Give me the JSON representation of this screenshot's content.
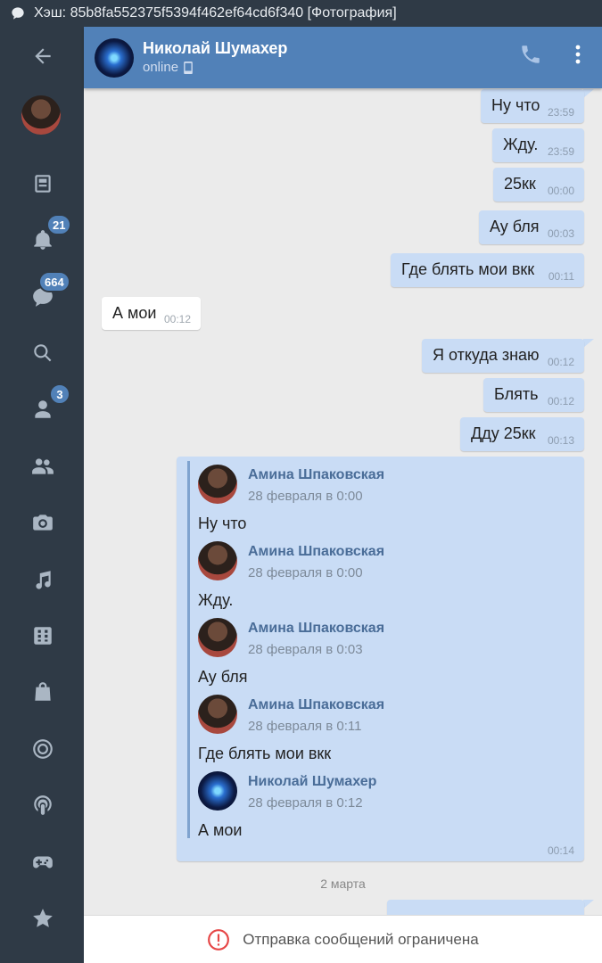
{
  "status_bar": {
    "notification": "Хэш: 85b8fa552375f5394f462ef64cd6f340 [Фотография]"
  },
  "sidebar": {
    "items": [
      {
        "name": "back",
        "icon": "arrow-left-icon"
      },
      {
        "name": "profile",
        "icon": "avatar"
      },
      {
        "name": "news",
        "icon": "newsfeed-icon"
      },
      {
        "name": "notifications",
        "icon": "bell-icon",
        "badge": "21"
      },
      {
        "name": "messages",
        "icon": "message-icon",
        "badge": "664"
      },
      {
        "name": "search",
        "icon": "search-icon"
      },
      {
        "name": "friends",
        "icon": "person-icon",
        "badge": "3"
      },
      {
        "name": "groups",
        "icon": "people-icon"
      },
      {
        "name": "photos",
        "icon": "camera-icon"
      },
      {
        "name": "music",
        "icon": "music-note-icon"
      },
      {
        "name": "apps",
        "icon": "grid-icon"
      },
      {
        "name": "market",
        "icon": "shopping-bag-icon"
      },
      {
        "name": "target",
        "icon": "target-icon"
      },
      {
        "name": "podcasts",
        "icon": "podcast-icon"
      },
      {
        "name": "games",
        "icon": "gamepad-icon"
      },
      {
        "name": "favorites",
        "icon": "star-icon"
      }
    ]
  },
  "header": {
    "title": "Николай Шумахер",
    "subtitle": "online",
    "accent": "#5181b8"
  },
  "messages": [
    {
      "text": "Ну что",
      "time": "23:59",
      "dir": "out"
    },
    {
      "text": "Жду.",
      "time": "23:59",
      "dir": "out"
    },
    {
      "text": "25кк",
      "time": "00:00",
      "dir": "out"
    },
    {
      "text": "Ау бля",
      "time": "00:03",
      "dir": "out"
    },
    {
      "text": "Где блять мои вкк",
      "time": "00:11",
      "dir": "out"
    },
    {
      "text": "А мои",
      "time": "00:12",
      "dir": "in"
    },
    {
      "text": "Я откуда знаю",
      "time": "00:12",
      "dir": "out"
    },
    {
      "text": "Блять",
      "time": "00:12",
      "dir": "out"
    },
    {
      "text": "Дду 25кк",
      "time": "00:13",
      "dir": "out"
    }
  ],
  "forwarded": {
    "time": "00:14",
    "items": [
      {
        "author": "Амина Шпаковская",
        "date": "28 февраля в 0:00",
        "text": "Ну что"
      },
      {
        "author": "Амина Шпаковская",
        "date": "28 февраля в 0:00",
        "text": "Жду."
      },
      {
        "author": "Амина Шпаковская",
        "date": "28 февраля в 0:03",
        "text": "Ау бля"
      },
      {
        "author": "Амина Шпаковская",
        "date": "28 февраля в 0:11",
        "text": "Где блять мои вкк"
      },
      {
        "author": "Николай Шумахер",
        "date": "28 февраля в 0:12",
        "text": "А мои"
      }
    ]
  },
  "date_separator": "2 марта",
  "bottom_bar": {
    "text": "Отправка сообщений ограничена",
    "status_color": "#e64646"
  }
}
